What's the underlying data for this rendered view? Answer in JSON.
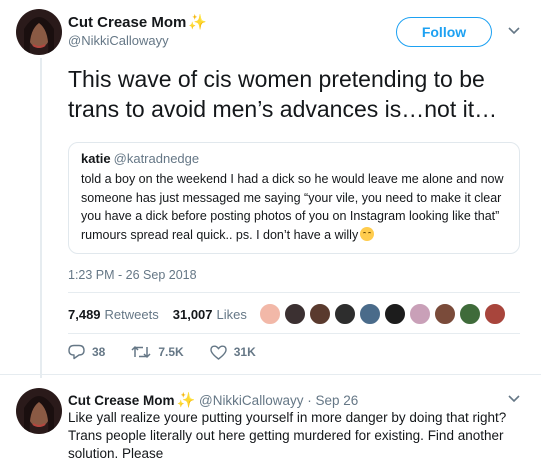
{
  "tweet": {
    "author_name": "Cut Crease Mom",
    "author_handle": "@NikkiCallowayy",
    "follow_label": "Follow",
    "text": "This wave of cis women pretending to be trans to avoid men’s advances is…not it…",
    "timestamp": "1:23 PM - 26 Sep 2018",
    "retweets_count": "7,489",
    "retweets_label": "Retweets",
    "likes_count": "31,007",
    "likes_label": "Likes",
    "actions": {
      "reply_count": "38",
      "retweet_count": "7.5K",
      "like_count": "31K"
    }
  },
  "quoted_tweet": {
    "author_name": "katie",
    "author_handle": "@katradnedge",
    "text": "told a boy on the weekend I had a dick so he would leave me alone and now someone has just messaged me saying “your vile, you need to make it clear you have a dick before posting photos of you on Instagram looking like that” rumours spread real quick.. ps. I don’t have a willy"
  },
  "liker_colors": [
    "#f2b8a8",
    "#3b3031",
    "#5a3a2e",
    "#2d2d2d",
    "#4a6b8a",
    "#1c1c1c",
    "#c9a0b8",
    "#7a4b3a",
    "#3f6b3a",
    "#a8453c"
  ],
  "reply": {
    "author_name": "Cut Crease Mom",
    "author_handle": "@NikkiCallowayy",
    "separator": "·",
    "date": "Sep 26",
    "text": "Like yall realize youre putting yourself in more danger by doing that right? Trans people literally out here getting murdered for existing. Find another solution. Please"
  },
  "colors": {
    "accent": "#1da1f2",
    "text": "#14171a",
    "muted": "#657786",
    "sparkle": "#f5b400"
  },
  "icons": {
    "verified_sparkle": "sparkles",
    "reply": "speech-bubble-icon",
    "retweet": "retweet-icon",
    "like": "heart-icon",
    "menu": "chevron-down-icon"
  }
}
